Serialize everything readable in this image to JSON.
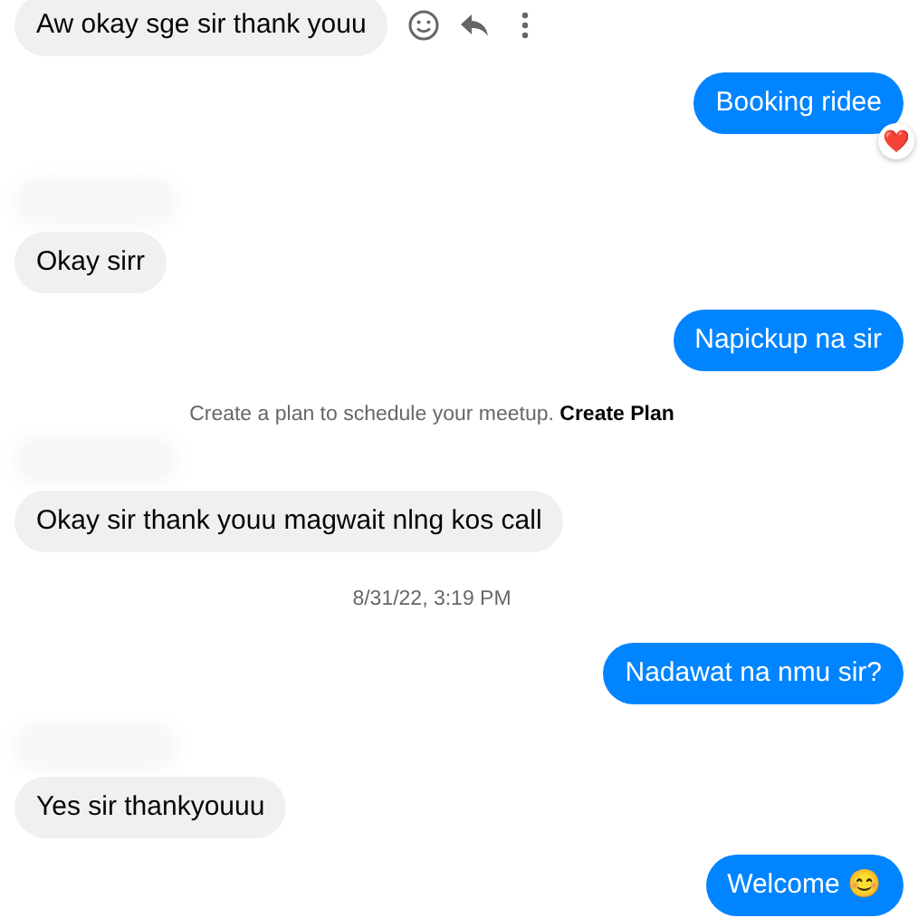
{
  "messages": [
    {
      "kind": "incoming",
      "text": "Aw okay sge sir thank youu",
      "actions": true
    },
    {
      "kind": "outgoing",
      "text": "Booking ridee",
      "reaction": "❤️"
    },
    {
      "kind": "redacted"
    },
    {
      "kind": "incoming",
      "text": "Okay sirr"
    },
    {
      "kind": "outgoing",
      "text": "Napickup na sir"
    },
    {
      "kind": "notice",
      "text": "Create a plan to schedule your meetup.",
      "link": "Create Plan"
    },
    {
      "kind": "redacted"
    },
    {
      "kind": "incoming",
      "text": "Okay sir thank youu magwait nlng kos call"
    },
    {
      "kind": "timestamp",
      "text": "8/31/22, 3:19 PM"
    },
    {
      "kind": "outgoing",
      "text": "Nadawat na nmu sir?"
    },
    {
      "kind": "redacted"
    },
    {
      "kind": "incoming",
      "text": "Yes sir thankyouuu"
    },
    {
      "kind": "outgoing",
      "text": "Welcome 😊"
    }
  ]
}
